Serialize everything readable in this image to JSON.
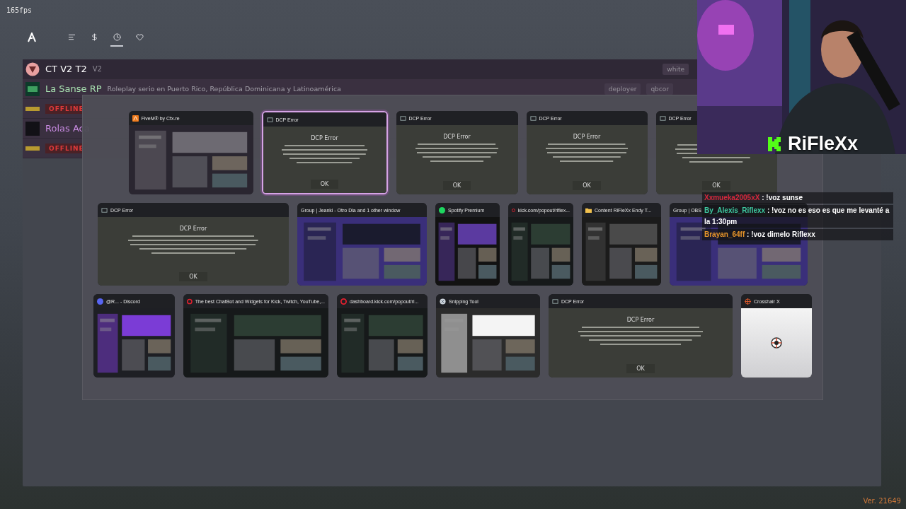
{
  "fps": "165fps",
  "nav": [
    {
      "selected": false
    },
    {
      "selected": false
    },
    {
      "selected": true
    },
    {
      "selected": false
    }
  ],
  "servers": [
    {
      "kind": "online",
      "name": "CT V2 T2",
      "tag": "V2",
      "labels": [
        "white"
      ]
    },
    {
      "kind": "online",
      "name": "La Sanse RP",
      "description": "Roleplay serio en Puerto Rico, República Dominicana y Latinoamérica",
      "labels": [
        "deployer",
        "qbcor"
      ]
    },
    {
      "kind": "offline",
      "badge": "OFFLINE"
    },
    {
      "kind": "online",
      "name": "Rolas Aca"
    },
    {
      "kind": "offline",
      "badge": "OFFLINE"
    }
  ],
  "switcher": {
    "windows": [
      {
        "title": "FiveM® by Cfx.re",
        "kind": "picture",
        "selected": false
      },
      {
        "title": "DCP Error",
        "kind": "dialog",
        "heading": "DCP Error",
        "button": "OK",
        "selected": true
      },
      {
        "title": "DCP Error",
        "kind": "dialog",
        "heading": "DCP Error",
        "button": "OK",
        "selected": false
      },
      {
        "title": "DCP Error",
        "kind": "dialog",
        "heading": "DCP Error",
        "button": "OK",
        "selected": false
      },
      {
        "title": "DCP Error",
        "kind": "dialog",
        "button": "OK",
        "selected": false
      },
      {
        "title": "DCP Error",
        "kind": "dialog",
        "heading": "DCP Error",
        "button": "OK",
        "selected": false
      },
      {
        "title": "Group | Jeanki - Otro Dia and 1 other window",
        "kind": "picture",
        "selected": false
      },
      {
        "title": "Spotify Premium",
        "kind": "picture",
        "selected": false
      },
      {
        "title": "kick.com/popout/riflex...",
        "kind": "picture",
        "selected": false
      },
      {
        "title": "Content RiFleXx Endy T...",
        "kind": "picture",
        "selected": false
      },
      {
        "title": "Group | OBS",
        "kind": "picture",
        "selected": false
      },
      {
        "title": "@R... - Discord",
        "kind": "picture",
        "selected": false
      },
      {
        "title": "The best ChatBot and Widgets for Kick, Twitch, YouTube,...",
        "kind": "picture",
        "selected": false
      },
      {
        "title": "dashboard.kick.com/popout/ri...",
        "kind": "picture",
        "selected": false
      },
      {
        "title": "Snipping Tool",
        "kind": "picture",
        "selected": false
      },
      {
        "title": "DCP Error",
        "kind": "dialog",
        "heading": "DCP Error",
        "button": "OK",
        "selected": false
      },
      {
        "title": "Crosshair X",
        "kind": "blank",
        "selected": false
      }
    ]
  },
  "webcam": {
    "channel": "RiFleXx"
  },
  "chat": [
    {
      "user": "Xxmueka2005xX",
      "color": "#d6283c",
      "text": ": !voz sunse"
    },
    {
      "user": "By_Alexis_Riflexx",
      "color": "#3ec9a0",
      "text": ": !voz no es eso es que me levanté a la 1:30pm"
    },
    {
      "user": "Brayan_64ff",
      "color": "#e8962a",
      "text": ": !voz dimelo Riflexx"
    }
  ],
  "version": "Ver. 21649"
}
